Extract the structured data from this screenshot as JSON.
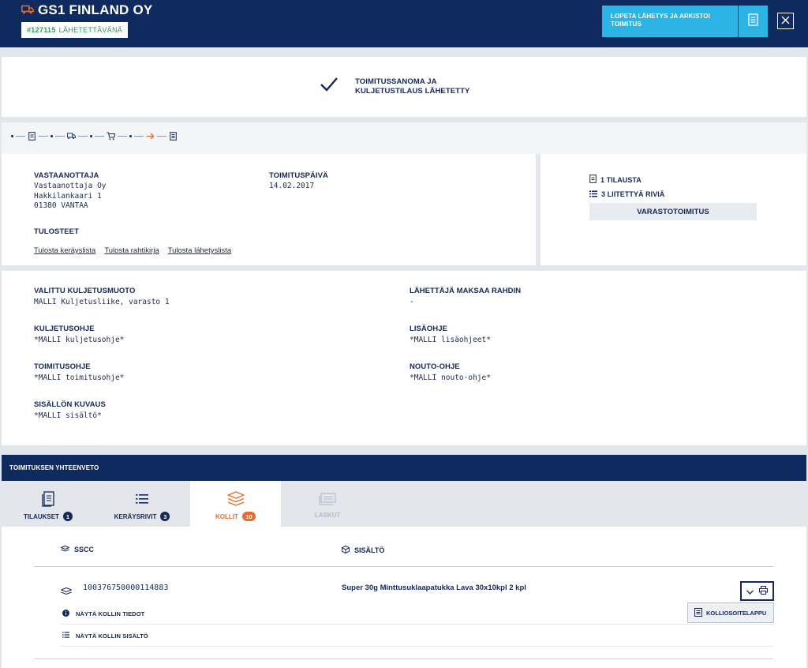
{
  "header": {
    "company": "GS1 FINLAND OY",
    "order_number": "#127115",
    "status": "LÄHETETTÄVÄNÄ",
    "archive_button": "LOPETA LÄHETYS JA ARKISTOI TOIMITUS",
    "accent": "#2cb4e5",
    "brand": "#0f2a5e"
  },
  "success": {
    "message": "TOIMITUSSANOMA JA KULJETUSTILAUS LÄHETETTY"
  },
  "progress": {
    "steps": [
      "dot",
      "document-icon",
      "dot",
      "truck-icon",
      "dot",
      "cart-icon",
      "dot",
      "arrow-right-icon",
      "document-list-icon"
    ]
  },
  "delivery": {
    "recipient_label": "VASTAANOTTAJA",
    "recipient_lines": [
      "Vastaanottaja Oy",
      "Hakkilankaari 1",
      "01380 VANTAA"
    ],
    "date_label": "TOIMITUSPÄIVÄ",
    "date": "14.02.2017",
    "prints_label": "TULOSTEET",
    "print_links": [
      "Tulosta keräyslista",
      "Tulosta rahtikirja",
      "Tulosta lähetyslista"
    ]
  },
  "side": {
    "orders": "1 TILAUSTA",
    "rows": "3 LIITETTYÄ RIVIÄ",
    "type": "VARASTOTOIMITUS"
  },
  "transport": {
    "method_label": "VALITTU KULJETUSMUOTO",
    "method": "MALLI Kuljetusliike, varasto 1",
    "payer_label": "LÄHETTÄJÄ MAKSAA RAHDIN",
    "payer": "-",
    "instructions_label": "KULJETUSOHJE",
    "instructions": "*MALLI kuljetusohje*",
    "extra_label": "LISÄOHJE",
    "extra": "*MALLI lisäohjeet*",
    "delivery_label": "TOIMITUSOHJE",
    "delivery": "*MALLI toimitusohje*",
    "pickup_label": "NOUTO-OHJE",
    "pickup": "*MALLI nouto-ohje*",
    "contents_label": "SISÄLLÖN KUVAUS",
    "contents": "*MALLI sisältö*"
  },
  "summary": {
    "title": "TOIMITUKSEN YHTEENVETO",
    "tabs": [
      {
        "label": "TILAUKSET",
        "count": "1"
      },
      {
        "label": "KERÄYSRIVIT",
        "count": "3"
      },
      {
        "label": "KOLLIT",
        "count": "10"
      },
      {
        "label": "LASKUT",
        "count": ""
      }
    ],
    "columns": {
      "sscc": "SSCC",
      "content": "SISÄLTÖ"
    },
    "package": {
      "sscc": "100376750000114883",
      "content": "Super 30g Minttusuklaapatukka Lava 30x10kpl 2 kpl",
      "show_details": "NÄYTÄ KOLLIN TIEDOT",
      "show_contents": "NÄYTÄ KOLLIN SISÄLTÖ",
      "label_button": "KOLLIOSOITELAPPU"
    },
    "active_color": "#ea6a2a"
  }
}
